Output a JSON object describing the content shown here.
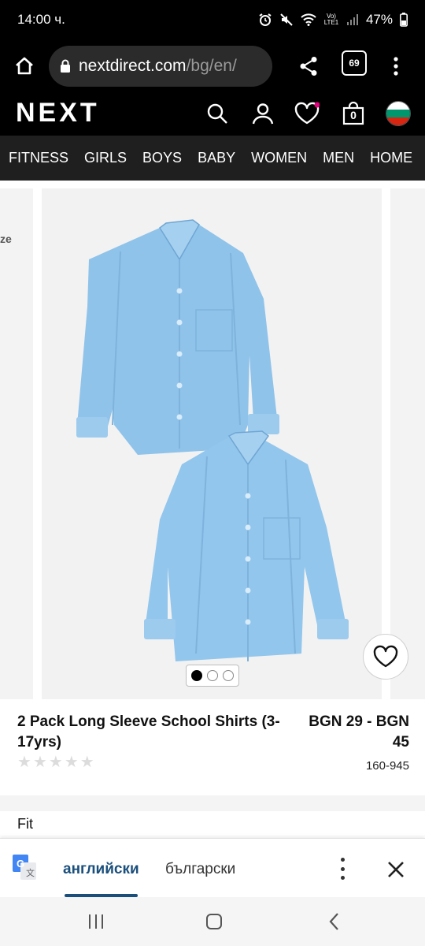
{
  "status_bar": {
    "time": "14:00 ч.",
    "battery": "47%",
    "network": "Vo) LTE1"
  },
  "browser": {
    "url_domain": "nextdirect.com",
    "url_path": "/bg/en/",
    "tab_count": "69"
  },
  "header": {
    "logo": "NEXT",
    "basket_count": "0",
    "colors": {
      "background": "#000000",
      "wishlist_dot": "#e6007e"
    }
  },
  "categories": [
    "FITNESS",
    "GIRLS",
    "BOYS",
    "BABY",
    "WOMEN",
    "MEN",
    "HOME"
  ],
  "carousel": {
    "left_card_text": "ze",
    "image_dots": 3,
    "active_dot": 0,
    "shirt_color": "#8fc3ea"
  },
  "product": {
    "title": "2 Pack Long Sleeve School Shirts (3-17yrs)",
    "price": "BGN 29 - BGN 45",
    "code": "160-945",
    "rating_stars": 5
  },
  "section": {
    "fit_label": "Fit"
  },
  "translate_bar": {
    "source_lang": "английски",
    "target_lang": "български"
  }
}
